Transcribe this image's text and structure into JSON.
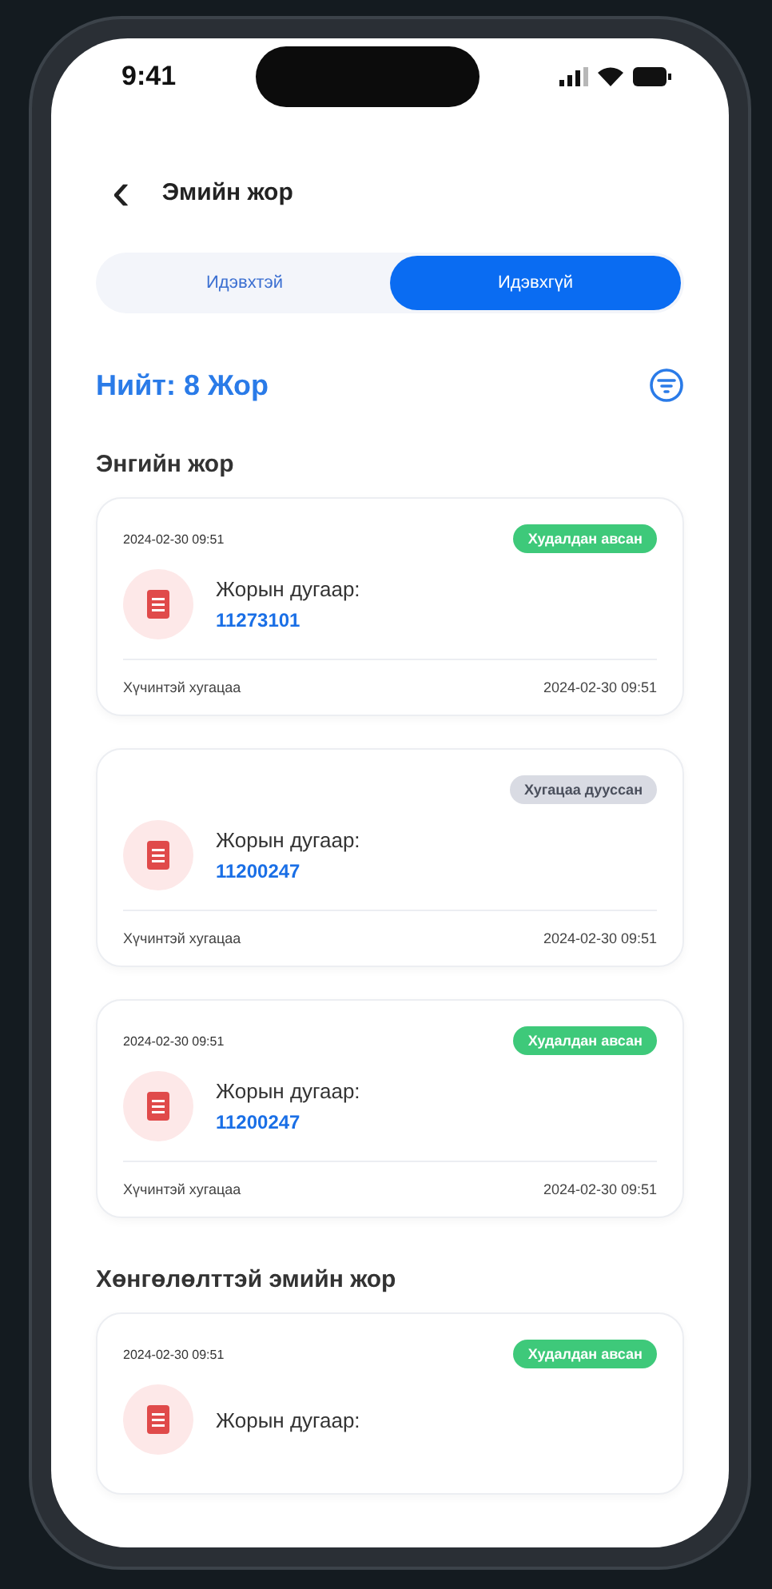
{
  "status_bar": {
    "time": "9:41"
  },
  "header": {
    "back": "‹",
    "title": "Эмийн жор"
  },
  "tabs": [
    {
      "label": "Идэвхтэй",
      "selected": false
    },
    {
      "label": "Идэвхгүй",
      "selected": true
    }
  ],
  "total": "Нийт: 8 Жор",
  "sections": [
    {
      "title": "Энгийн жор",
      "cards": [
        {
          "date": "2024-02-30 09:51",
          "status": {
            "kind": "purchased",
            "label": "Худалдан авсан"
          },
          "number_label": "Жорын дугаар:",
          "number": "11273101",
          "validity_label": "Хүчинтэй хугацаа",
          "validity": "2024-02-30 09:51"
        },
        {
          "status": {
            "kind": "expired",
            "label": "Хугацаа дууссан"
          },
          "number_label": "Жорын дугаар:",
          "number": "11200247",
          "validity_label": "Хүчинтэй хугацаа",
          "validity": "2024-02-30 09:51"
        },
        {
          "date": "2024-02-30 09:51",
          "status": {
            "kind": "purchased",
            "label": "Худалдан авсан"
          },
          "number_label": "Жорын дугаар:",
          "number": "11200247",
          "validity_label": "Хүчинтэй хугацаа",
          "validity": "2024-02-30 09:51"
        }
      ]
    },
    {
      "title": "Хөнгөлөлттэй эмийн жор",
      "cards": [
        {
          "date": "2024-02-30 09:51",
          "status": {
            "kind": "purchased",
            "label": "Худалдан авсан"
          },
          "number_label": "Жорын дугаар:"
        }
      ]
    }
  ]
}
